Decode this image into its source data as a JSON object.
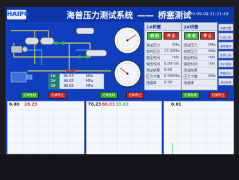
{
  "header": {
    "logo": "HAIPU",
    "title_main": "海普压力测试系统",
    "title_sep": "——",
    "title_sub": "桥塞测试",
    "datetime": "2020-09-09  21:21:49"
  },
  "pipe_table": {
    "headers": [
      "",
      "",
      ""
    ],
    "rows": [
      [
        "1#",
        "86.63",
        "MPa"
      ],
      [
        "2#",
        "86.63",
        "MPa"
      ],
      [
        "3#",
        "86.63",
        "MPa"
      ]
    ]
  },
  "panel1": {
    "title": "1#桥塞",
    "start_label": "启 动",
    "stop_label": "停 止",
    "rows": [
      {
        "label": "测试压力",
        "value": "",
        "unit": "MPa"
      },
      {
        "label": "实时压力",
        "value": "27.3",
        "unit": "MPa"
      },
      {
        "label": "稳压时间",
        "value": "",
        "unit": "min"
      },
      {
        "label": "保压时间",
        "value": "0.00",
        "unit": "min"
      },
      {
        "label": "测试结果",
        "value": "0.00",
        "unit": ""
      },
      {
        "label": "压力下降",
        "value": "0.00",
        "unit": "MPa"
      },
      {
        "label": "泄漏率",
        "value": "0.00",
        "unit": ""
      }
    ]
  },
  "panel2": {
    "title": "2#桥塞",
    "start_label": "启 动",
    "stop_label": "停 止",
    "rows": [
      {
        "label": "测试压力",
        "value": "",
        "unit": "MPa"
      },
      {
        "label": "实时压力",
        "value": "",
        "unit": "MPa"
      },
      {
        "label": "稳压时间",
        "value": "",
        "unit": "min"
      },
      {
        "label": "保压时间",
        "value": "",
        "unit": "min"
      },
      {
        "label": "测试结果",
        "value": "",
        "unit": ""
      },
      {
        "label": "压力下降",
        "value": "",
        "unit": "MPa"
      },
      {
        "label": "泄漏率",
        "value": "",
        "unit": ""
      }
    ]
  },
  "side_buttons": [
    "参数设置",
    "历史记录",
    "曲线查询",
    "报警记录",
    "用户管理",
    "数据导出",
    "退出系统"
  ],
  "charts": [
    {
      "start_label": "记录曲线",
      "stop_label": "记录停止",
      "values": [
        "0.00",
        "28.29"
      ]
    },
    {
      "start_label": "记录曲线",
      "stop_label": "记录停止",
      "values": [
        "76.23",
        "86.03",
        "33.02"
      ]
    },
    {
      "start_label": "记录曲线",
      "stop_label": "记录停止",
      "values": [
        "0.01"
      ]
    }
  ],
  "colors": {
    "screen_bg": "#0f3fbf",
    "start_green": "#3dbb3d",
    "stop_red": "#d22a2a",
    "curve_red": "#d6342f",
    "curve_green": "#2bb14a"
  }
}
